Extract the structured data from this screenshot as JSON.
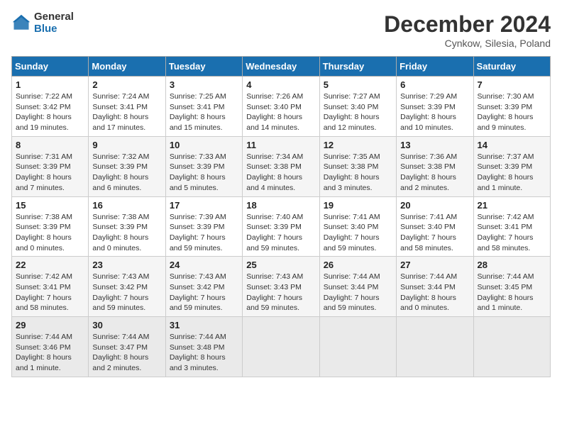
{
  "header": {
    "logo_general": "General",
    "logo_blue": "Blue",
    "month_title": "December 2024",
    "location": "Cynkow, Silesia, Poland"
  },
  "calendar": {
    "days_of_week": [
      "Sunday",
      "Monday",
      "Tuesday",
      "Wednesday",
      "Thursday",
      "Friday",
      "Saturday"
    ],
    "weeks": [
      [
        {
          "day": "1",
          "sunrise": "7:22 AM",
          "sunset": "3:42 PM",
          "daylight": "8 hours and 19 minutes."
        },
        {
          "day": "2",
          "sunrise": "7:24 AM",
          "sunset": "3:41 PM",
          "daylight": "8 hours and 17 minutes."
        },
        {
          "day": "3",
          "sunrise": "7:25 AM",
          "sunset": "3:41 PM",
          "daylight": "8 hours and 15 minutes."
        },
        {
          "day": "4",
          "sunrise": "7:26 AM",
          "sunset": "3:40 PM",
          "daylight": "8 hours and 14 minutes."
        },
        {
          "day": "5",
          "sunrise": "7:27 AM",
          "sunset": "3:40 PM",
          "daylight": "8 hours and 12 minutes."
        },
        {
          "day": "6",
          "sunrise": "7:29 AM",
          "sunset": "3:39 PM",
          "daylight": "8 hours and 10 minutes."
        },
        {
          "day": "7",
          "sunrise": "7:30 AM",
          "sunset": "3:39 PM",
          "daylight": "8 hours and 9 minutes."
        }
      ],
      [
        {
          "day": "8",
          "sunrise": "7:31 AM",
          "sunset": "3:39 PM",
          "daylight": "8 hours and 7 minutes."
        },
        {
          "day": "9",
          "sunrise": "7:32 AM",
          "sunset": "3:39 PM",
          "daylight": "8 hours and 6 minutes."
        },
        {
          "day": "10",
          "sunrise": "7:33 AM",
          "sunset": "3:39 PM",
          "daylight": "8 hours and 5 minutes."
        },
        {
          "day": "11",
          "sunrise": "7:34 AM",
          "sunset": "3:38 PM",
          "daylight": "8 hours and 4 minutes."
        },
        {
          "day": "12",
          "sunrise": "7:35 AM",
          "sunset": "3:38 PM",
          "daylight": "8 hours and 3 minutes."
        },
        {
          "day": "13",
          "sunrise": "7:36 AM",
          "sunset": "3:38 PM",
          "daylight": "8 hours and 2 minutes."
        },
        {
          "day": "14",
          "sunrise": "7:37 AM",
          "sunset": "3:39 PM",
          "daylight": "8 hours and 1 minute."
        }
      ],
      [
        {
          "day": "15",
          "sunrise": "7:38 AM",
          "sunset": "3:39 PM",
          "daylight": "8 hours and 0 minutes."
        },
        {
          "day": "16",
          "sunrise": "7:38 AM",
          "sunset": "3:39 PM",
          "daylight": "8 hours and 0 minutes."
        },
        {
          "day": "17",
          "sunrise": "7:39 AM",
          "sunset": "3:39 PM",
          "daylight": "7 hours and 59 minutes."
        },
        {
          "day": "18",
          "sunrise": "7:40 AM",
          "sunset": "3:39 PM",
          "daylight": "7 hours and 59 minutes."
        },
        {
          "day": "19",
          "sunrise": "7:41 AM",
          "sunset": "3:40 PM",
          "daylight": "7 hours and 59 minutes."
        },
        {
          "day": "20",
          "sunrise": "7:41 AM",
          "sunset": "3:40 PM",
          "daylight": "7 hours and 58 minutes."
        },
        {
          "day": "21",
          "sunrise": "7:42 AM",
          "sunset": "3:41 PM",
          "daylight": "7 hours and 58 minutes."
        }
      ],
      [
        {
          "day": "22",
          "sunrise": "7:42 AM",
          "sunset": "3:41 PM",
          "daylight": "7 hours and 58 minutes."
        },
        {
          "day": "23",
          "sunrise": "7:43 AM",
          "sunset": "3:42 PM",
          "daylight": "7 hours and 59 minutes."
        },
        {
          "day": "24",
          "sunrise": "7:43 AM",
          "sunset": "3:42 PM",
          "daylight": "7 hours and 59 minutes."
        },
        {
          "day": "25",
          "sunrise": "7:43 AM",
          "sunset": "3:43 PM",
          "daylight": "7 hours and 59 minutes."
        },
        {
          "day": "26",
          "sunrise": "7:44 AM",
          "sunset": "3:44 PM",
          "daylight": "7 hours and 59 minutes."
        },
        {
          "day": "27",
          "sunrise": "7:44 AM",
          "sunset": "3:44 PM",
          "daylight": "8 hours and 0 minutes."
        },
        {
          "day": "28",
          "sunrise": "7:44 AM",
          "sunset": "3:45 PM",
          "daylight": "8 hours and 1 minute."
        }
      ],
      [
        {
          "day": "29",
          "sunrise": "7:44 AM",
          "sunset": "3:46 PM",
          "daylight": "8 hours and 1 minute."
        },
        {
          "day": "30",
          "sunrise": "7:44 AM",
          "sunset": "3:47 PM",
          "daylight": "8 hours and 2 minutes."
        },
        {
          "day": "31",
          "sunrise": "7:44 AM",
          "sunset": "3:48 PM",
          "daylight": "8 hours and 3 minutes."
        },
        null,
        null,
        null,
        null
      ]
    ]
  }
}
